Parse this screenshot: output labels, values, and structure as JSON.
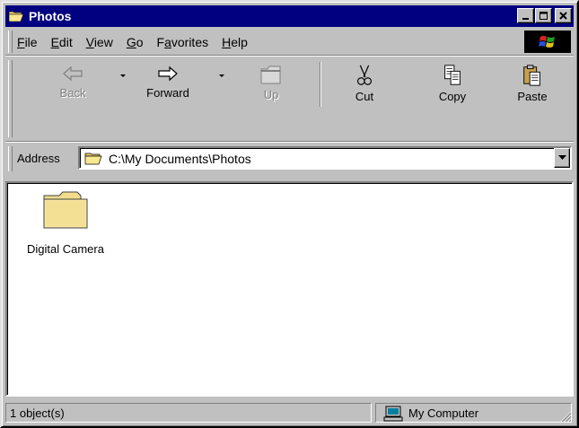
{
  "window": {
    "title": "Photos",
    "title_bar_color": "#000080"
  },
  "menubar": {
    "items": [
      {
        "pre": "",
        "key": "F",
        "post": "ile"
      },
      {
        "pre": "",
        "key": "E",
        "post": "dit"
      },
      {
        "pre": "",
        "key": "V",
        "post": "iew"
      },
      {
        "pre": "",
        "key": "G",
        "post": "o"
      },
      {
        "pre": "F",
        "key": "a",
        "post": "vorites"
      },
      {
        "pre": "",
        "key": "H",
        "post": "elp"
      }
    ]
  },
  "toolbar": {
    "back_label": "Back",
    "forward_label": "Forward",
    "up_label": "Up",
    "cut_label": "Cut",
    "copy_label": "Copy",
    "paste_label": "Paste"
  },
  "address": {
    "label": "Address",
    "value": "C:\\My Documents\\Photos"
  },
  "content": {
    "items": [
      {
        "name": "Digital Camera",
        "icon": "folder-icon"
      }
    ]
  },
  "status": {
    "count": "1 object(s)",
    "zone": "My Computer"
  }
}
